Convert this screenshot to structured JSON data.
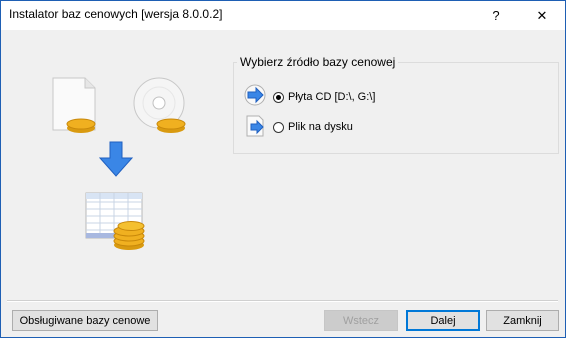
{
  "window": {
    "title": "Instalator baz cenowych  [wersja 8.0.0.2]",
    "help_label": "?",
    "close_label": "✕"
  },
  "source_group": {
    "label": "Wybierz źródło bazy cenowej",
    "options": [
      {
        "label": "Płyta CD  [D:\\, G:\\]",
        "selected": true
      },
      {
        "label": "Plik na dysku",
        "selected": false
      }
    ]
  },
  "buttons": {
    "supported": "Obsługiwane bazy cenowe",
    "back": "Wstecz",
    "next": "Dalej",
    "close": "Zamknij"
  },
  "colors": {
    "accent": "#0078d7",
    "arrow_blue": "#3a86e6",
    "coin_gold": "#f0b020"
  }
}
